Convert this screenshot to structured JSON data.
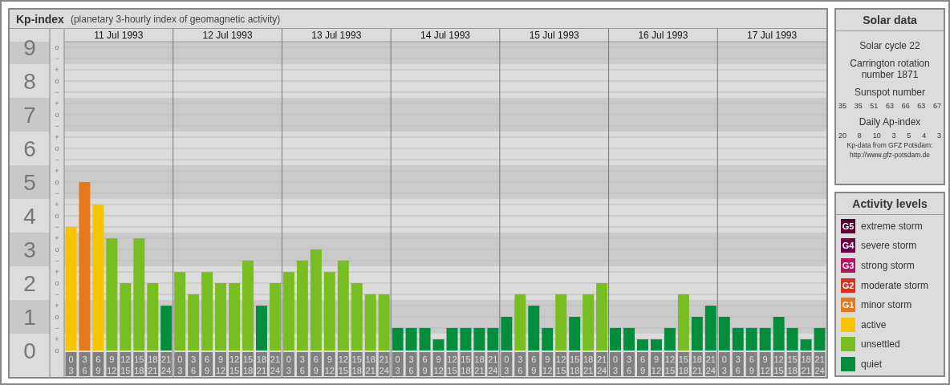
{
  "header": {
    "title": "Kp-index",
    "subtitle": "(planetary 3-hourly index of geomagnetic activity)"
  },
  "kp_chart": {
    "day_labels": [
      "11 Jul 1993",
      "12 Jul 1993",
      "13 Jul 1993",
      "14 Jul 1993",
      "15 Jul 1993",
      "16 Jul 1993",
      "17 Jul 1993"
    ],
    "minor_tick_labels": [
      "o",
      "−",
      "+",
      "o",
      "−",
      "+",
      "o",
      "−",
      "+",
      "o",
      "−",
      "+",
      "o",
      "−",
      "+",
      "o",
      "−",
      "+",
      "o",
      "−",
      "+",
      "o",
      "−",
      "+",
      "o",
      "−",
      "+",
      "o"
    ],
    "chart_data": {
      "type": "bar",
      "ylim": [
        0,
        9
      ],
      "grid": true,
      "yticks": [
        0,
        1,
        2,
        3,
        4,
        5,
        6,
        7,
        8,
        9
      ],
      "categories": [
        "0 3",
        "3 6",
        "6 9",
        "9 12",
        "12 15",
        "15 18",
        "18 21",
        "21 24",
        "0 3",
        "3 6",
        "6 9",
        "9 12",
        "12 15",
        "15 18",
        "18 21",
        "21 24",
        "0 3",
        "3 6",
        "6 9",
        "9 12",
        "12 15",
        "15 18",
        "18 21",
        "21 24",
        "0 3",
        "3 6",
        "6 9",
        "9 12",
        "12 15",
        "15 18",
        "18 21",
        "21 24",
        "0 3",
        "3 6",
        "6 9",
        "9 12",
        "12 15",
        "15 18",
        "18 21",
        "21 24",
        "0 3",
        "3 6",
        "6 9",
        "9 12",
        "12 15",
        "15 18",
        "18 21",
        "21 24",
        "0 3",
        "3 6",
        "6 9",
        "9 12",
        "12 15",
        "15 18",
        "18 21",
        "21 24"
      ],
      "series": [
        {
          "values": [
            3.67,
            5,
            4.33,
            3.33,
            2,
            3.33,
            2,
            1.33,
            2.33,
            1.67,
            2.33,
            2,
            2,
            2.67,
            1.33,
            2,
            2.33,
            2.67,
            3,
            2.33,
            2.67,
            2,
            1.67,
            1.67,
            0.67,
            0.67,
            0.67,
            0.33,
            0.67,
            0.67,
            0.67,
            0.67,
            1,
            1.67,
            1.33,
            0.67,
            1.67,
            1,
            1.67,
            2,
            0.67,
            0.67,
            0.33,
            0.33,
            0.67,
            1.67,
            1,
            1.33,
            1,
            0.67,
            0.67,
            0.67,
            1,
            0.67,
            0.33,
            0.67
          ]
        }
      ]
    }
  },
  "solar_data": {
    "title": "Solar data",
    "cycle": "Solar cycle 22",
    "carrington": "Carrington rotation number 1871",
    "sunspot_title": "Sunspot number",
    "sunspots": [
      "35",
      "35",
      "51",
      "63",
      "66",
      "63",
      "67"
    ],
    "ap_title": "Daily Ap-index",
    "ap": [
      "20",
      "8",
      "10",
      "3",
      "5",
      "4",
      "3"
    ],
    "source": "Kp-data from GFZ Potsdam:",
    "source_url": "http://www.gfz-potsdam.de"
  },
  "activity_levels": {
    "title": "Activity levels",
    "items": [
      {
        "badge": "G5",
        "label": "extreme storm",
        "color": "#55002e"
      },
      {
        "badge": "G4",
        "label": "severe storm",
        "color": "#6e0042"
      },
      {
        "badge": "G3",
        "label": "strong storm",
        "color": "#ae1460"
      },
      {
        "badge": "G2",
        "label": "moderate storm",
        "color": "#d8321e"
      },
      {
        "badge": "G1",
        "label": "minor storm",
        "color": "#e57818"
      },
      {
        "label": "active",
        "color": "#f8c400"
      },
      {
        "label": "unsettled",
        "color": "#78be20"
      },
      {
        "label": "quiet",
        "color": "#008e3c"
      }
    ]
  }
}
